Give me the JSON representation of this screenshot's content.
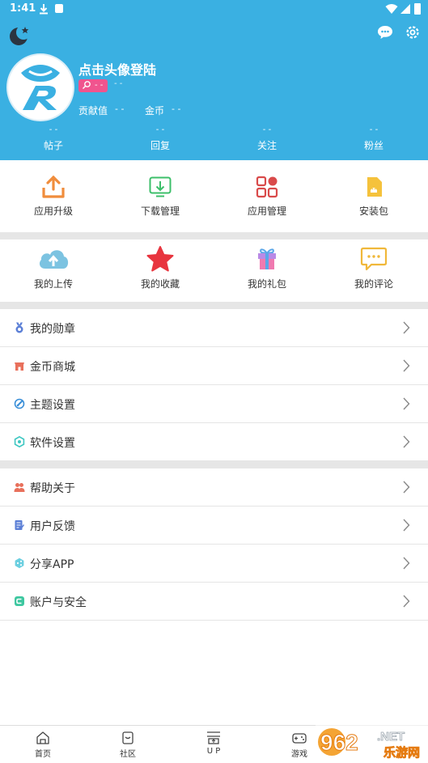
{
  "status_bar": {
    "time": "1:41"
  },
  "profile": {
    "login_prompt": "点击头像登陆",
    "level_value": "- -",
    "level_extra": "- -",
    "contribution_label": "贡献值",
    "contribution_value": "- -",
    "coins_label": "金币",
    "coins_value": "- -"
  },
  "stats": [
    {
      "value": "- -",
      "label": "帖子"
    },
    {
      "value": "- -",
      "label": "回复"
    },
    {
      "value": "- -",
      "label": "关注"
    },
    {
      "value": "- -",
      "label": "粉丝"
    }
  ],
  "tools": [
    {
      "label": "应用升级",
      "icon": "upload-tray-icon"
    },
    {
      "label": "下载管理",
      "icon": "download-icon"
    },
    {
      "label": "应用管理",
      "icon": "app-grid-icon"
    },
    {
      "label": "安装包",
      "icon": "apk-package-icon"
    }
  ],
  "personal": [
    {
      "label": "我的上传",
      "icon": "cloud-upload-icon"
    },
    {
      "label": "我的收藏",
      "icon": "star-icon"
    },
    {
      "label": "我的礼包",
      "icon": "gift-icon"
    },
    {
      "label": "我的评论",
      "icon": "comment-icon"
    }
  ],
  "menu_group_1": [
    {
      "label": "我的勋章",
      "icon": "medal-icon",
      "color": "#5b7fd6"
    },
    {
      "label": "金币商城",
      "icon": "shop-icon",
      "color": "#e8705b"
    },
    {
      "label": "主题设置",
      "icon": "palette-icon",
      "color": "#3a8fd8"
    },
    {
      "label": "软件设置",
      "icon": "settings-icon",
      "color": "#3ec7c2"
    }
  ],
  "menu_group_2": [
    {
      "label": "帮助关于",
      "icon": "help-icon",
      "color": "#e8705b"
    },
    {
      "label": "用户反馈",
      "icon": "feedback-icon",
      "color": "#5b7fd6"
    },
    {
      "label": "分享APP",
      "icon": "share-icon",
      "color": "#6bcfe0"
    },
    {
      "label": "账户与安全",
      "icon": "account-security-icon",
      "color": "#3ec7a0"
    }
  ],
  "bottom_nav": [
    {
      "label": "首页",
      "icon": "home-icon"
    },
    {
      "label": "社区",
      "icon": "community-icon"
    },
    {
      "label": "U P",
      "icon": "up-icon"
    },
    {
      "label": "游戏",
      "icon": "gamepad-icon"
    }
  ],
  "watermark": {
    "brand_number": "962",
    "brand_suffix": ".NET",
    "brand_text": "乐游网"
  },
  "colors": {
    "header": "#3ab0e2",
    "badge": "#f0548e",
    "separator": "#e6e6e6"
  }
}
